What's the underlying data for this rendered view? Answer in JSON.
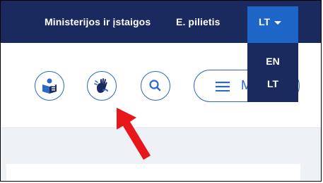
{
  "topnav": {
    "ministries_label": "Ministerijos ir įstaigos",
    "epilietis_label": "E. pilietis",
    "language_label": "LT"
  },
  "language_dropdown": {
    "options": [
      "EN",
      "LT"
    ]
  },
  "toolbar": {
    "buttons": [
      "easy-read-icon",
      "sign-language-icon",
      "search-icon"
    ],
    "menu_label": "M"
  },
  "colors": {
    "topbar": "#1b2a5e",
    "accent": "#1d66c7",
    "outline": "#2c68c6",
    "content_bg": "#eef1f6",
    "annotation_arrow": "#e8171b"
  }
}
